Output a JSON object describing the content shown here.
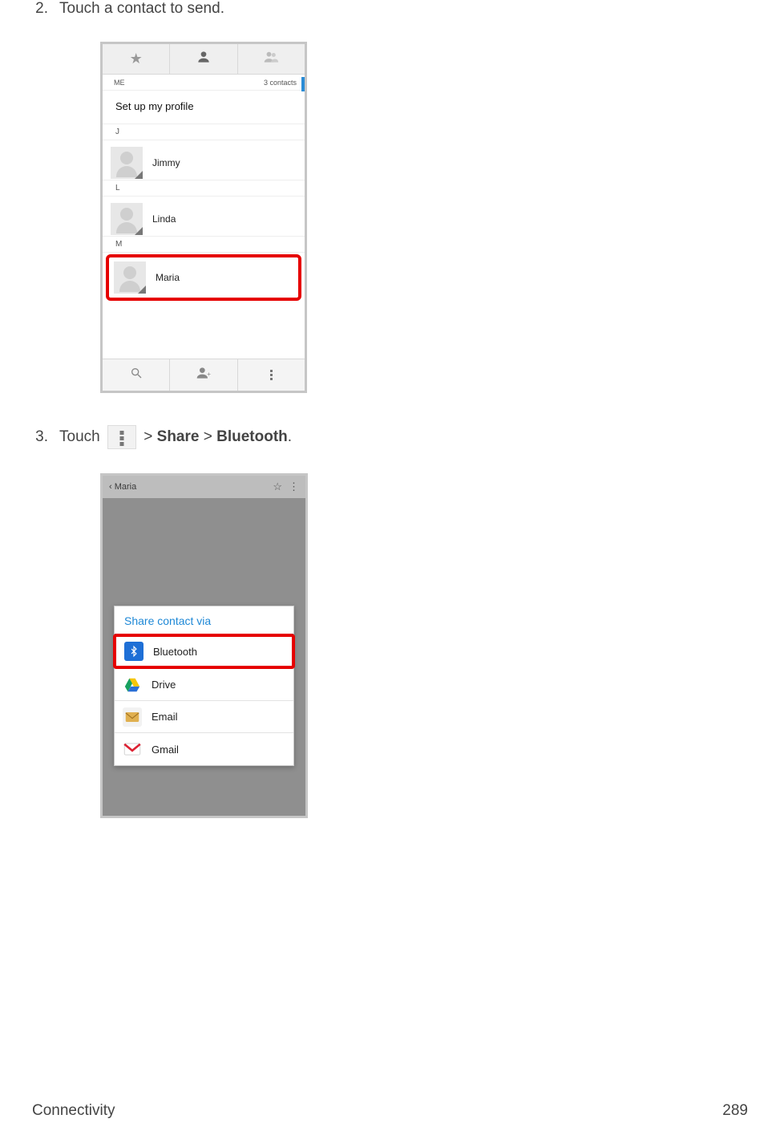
{
  "steps": {
    "s2": {
      "num": "2.",
      "text": "Touch a contact to send."
    },
    "s3": {
      "num": "3.",
      "prefix": "Touch ",
      "mid": " > ",
      "share": "Share",
      "bluetooth": "Bluetooth",
      "period": "."
    }
  },
  "shot1": {
    "me_label": "ME",
    "count": "3 contacts",
    "profile": "Set up my profile",
    "sections": {
      "J": "J",
      "L": "L",
      "M": "M"
    },
    "contacts": {
      "jimmy": "Jimmy",
      "linda": "Linda",
      "maria": "Maria"
    }
  },
  "shot2": {
    "back_label": "Maria",
    "dialog_title": "Share contact via",
    "options": {
      "bluetooth": "Bluetooth",
      "drive": "Drive",
      "email": "Email",
      "gmail": "Gmail"
    }
  },
  "footer": {
    "section": "Connectivity",
    "page": "289"
  }
}
